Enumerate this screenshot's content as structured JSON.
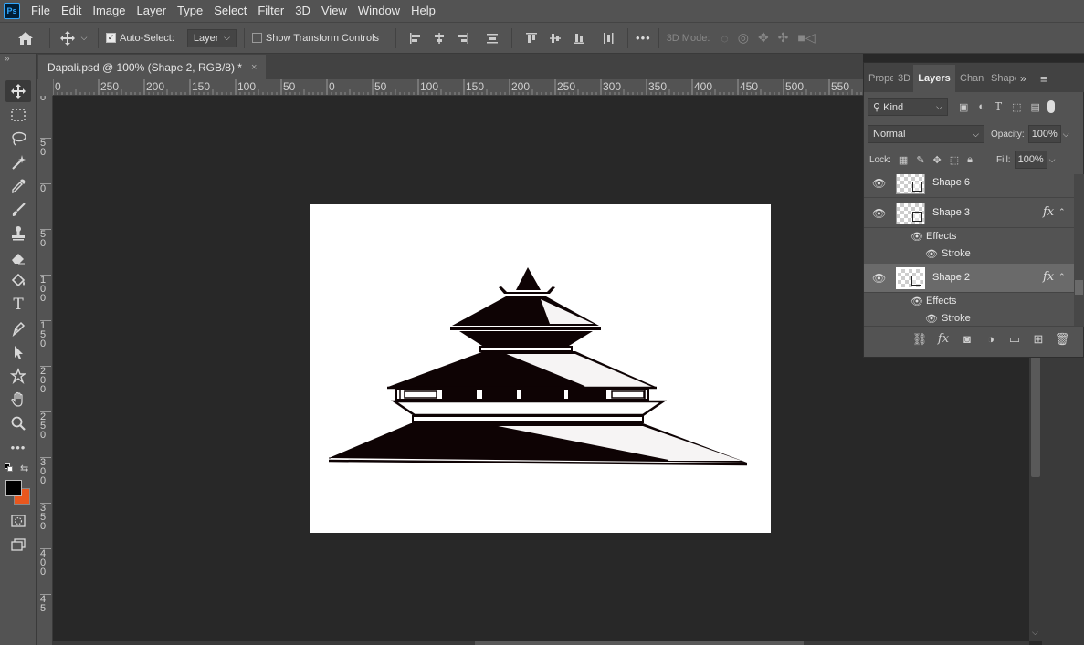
{
  "app": {
    "logo": "Ps"
  },
  "menu": [
    "File",
    "Edit",
    "Image",
    "Layer",
    "Type",
    "Select",
    "Filter",
    "3D",
    "View",
    "Window",
    "Help"
  ],
  "options_bar": {
    "auto_select_label": "Auto-Select:",
    "auto_select_checked": true,
    "auto_select_target": "Layer",
    "transform_controls_label": "Show Transform Controls",
    "transform_controls_checked": false,
    "more_label": "•••",
    "mode_3d_label": "3D Mode:"
  },
  "document": {
    "tab_title": "Dapali.psd @ 100% (Shape 2, RGB/8) *",
    "close_glyph": "×",
    "background_color": "#ffffff"
  },
  "ruler": {
    "top_labels": [
      "0",
      "250",
      "200",
      "150",
      "100",
      "50",
      "0",
      "50",
      "100",
      "150",
      "200",
      "250",
      "300",
      "350",
      "400",
      "450",
      "500",
      "550"
    ],
    "left_labels": [
      "0",
      "5\n0",
      "0",
      "5\n0",
      "1\n0\n0",
      "1\n5\n0",
      "2\n0\n0",
      "2\n5\n0",
      "3\n0\n0",
      "3\n5\n0",
      "4\n0\n0",
      "4\n5"
    ]
  },
  "panel": {
    "tabs": [
      "Prope",
      "3D",
      "Layers",
      "Chan",
      "Shape"
    ],
    "active_tab": "Layers",
    "filter_kind": "Kind",
    "blend_mode": "Normal",
    "opacity_label": "Opacity:",
    "opacity_value": "100%",
    "lock_label": "Lock:",
    "fill_label": "Fill:",
    "fill_value": "100%",
    "layers": [
      {
        "name": "Shape 6",
        "fx": "",
        "selected": false
      },
      {
        "name": "Shape 3",
        "fx": "fx",
        "selected": false,
        "effects_label": "Effects",
        "stroke_label": "Stroke"
      },
      {
        "name": "Shape 2",
        "fx": "fx",
        "selected": true,
        "effects_label": "Effects",
        "stroke_label": "Stroke"
      }
    ]
  },
  "colors": {
    "foreground": "#000000",
    "background": "#e8571e",
    "accent": "#31a8ff"
  },
  "tools": [
    "move-icon",
    "marquee-icon",
    "lasso-icon",
    "magic-wand-icon",
    "eyedropper-icon",
    "brush-icon",
    "stamp-icon",
    "eraser-icon",
    "paint-bucket-icon",
    "type-icon",
    "pen-icon",
    "path-select-icon",
    "custom-shape-icon",
    "hand-icon",
    "zoom-icon",
    "more-icon"
  ]
}
